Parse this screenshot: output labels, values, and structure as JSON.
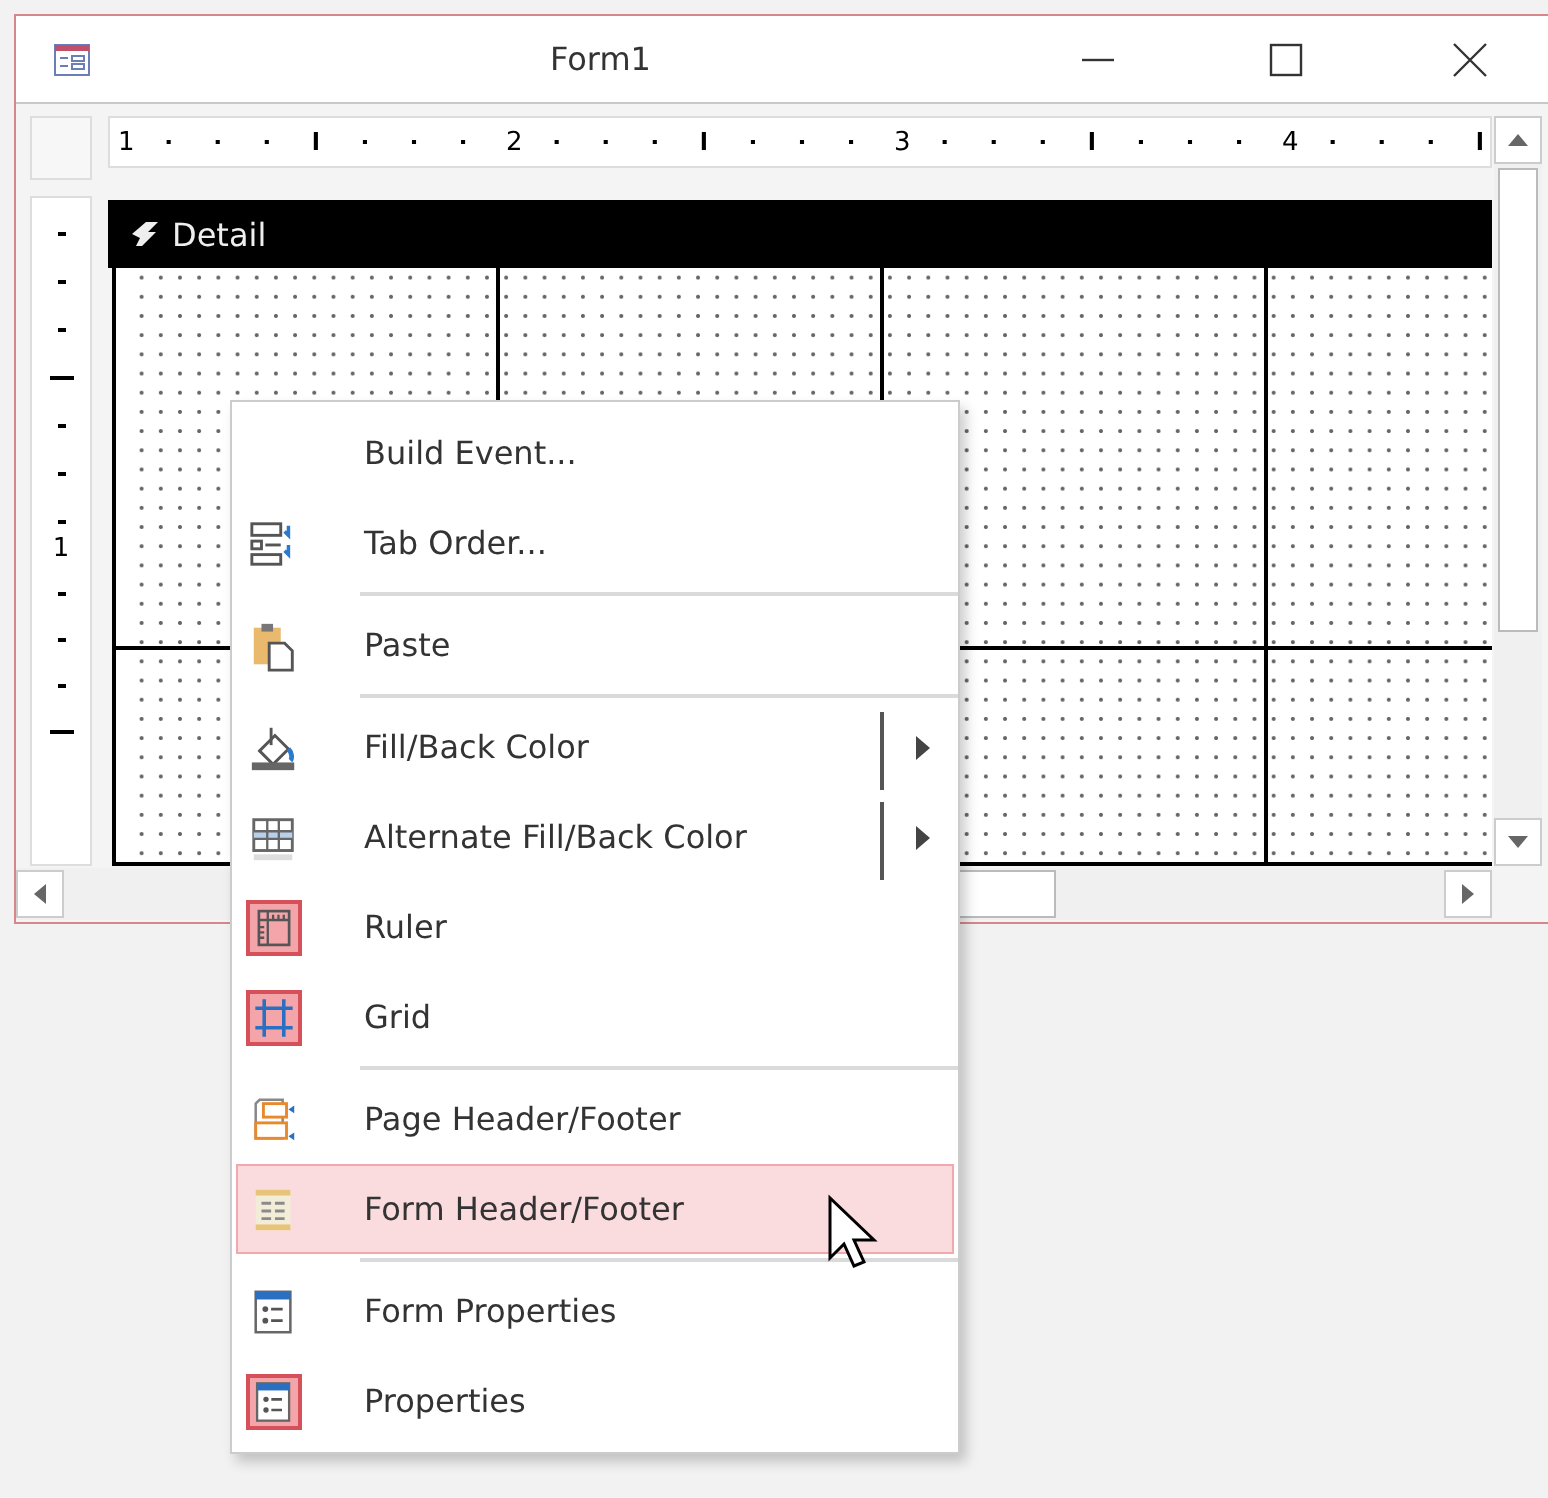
{
  "window": {
    "title": "Form1"
  },
  "horizontal_ruler": {
    "labels": [
      "1",
      "2",
      "3",
      "4"
    ]
  },
  "vertical_ruler": {
    "labels": [
      "1"
    ]
  },
  "section": {
    "title": "Detail"
  },
  "context_menu": {
    "items": [
      {
        "kind": "item",
        "label": "Build Event...",
        "checked": false,
        "selected": false,
        "submenu": false
      },
      {
        "kind": "item",
        "label": "Tab Order...",
        "checked": false,
        "selected": false,
        "submenu": false
      },
      {
        "kind": "separator"
      },
      {
        "kind": "item",
        "label": "Paste",
        "checked": false,
        "selected": false,
        "submenu": false
      },
      {
        "kind": "separator"
      },
      {
        "kind": "item",
        "label": "Fill/Back Color",
        "checked": false,
        "selected": false,
        "submenu": true
      },
      {
        "kind": "item",
        "label": "Alternate Fill/Back Color",
        "checked": false,
        "selected": false,
        "submenu": true
      },
      {
        "kind": "item",
        "label": "Ruler",
        "checked": true,
        "selected": false,
        "submenu": false
      },
      {
        "kind": "item",
        "label": "Grid",
        "checked": true,
        "selected": false,
        "submenu": false
      },
      {
        "kind": "separator"
      },
      {
        "kind": "item",
        "label": "Page Header/Footer",
        "checked": false,
        "selected": false,
        "submenu": false
      },
      {
        "kind": "item",
        "label": "Form Header/Footer",
        "checked": false,
        "selected": true,
        "submenu": false
      },
      {
        "kind": "separator"
      },
      {
        "kind": "item",
        "label": "Form Properties",
        "checked": false,
        "selected": false,
        "submenu": false
      },
      {
        "kind": "item",
        "label": "Properties",
        "checked": true,
        "selected": false,
        "submenu": false
      }
    ]
  }
}
